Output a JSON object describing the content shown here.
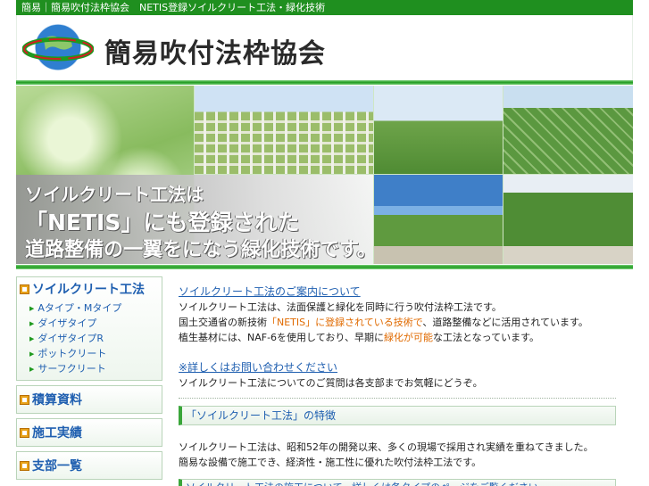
{
  "topbar": {
    "text": "簡易｜簡易吹付法枠協会　NETIS登録ソイルクリート工法・緑化技術"
  },
  "header": {
    "title": "簡易吹付法枠協会",
    "logo_icon": "globe-ring-logo"
  },
  "banner": {
    "lines": [
      "ソイルクリート工法は",
      "「NETIS」にも登録された",
      "道路整備の一翼をになう緑化技術です。"
    ]
  },
  "sidebar": {
    "sections": [
      {
        "label": "ソイルクリート工法",
        "items": [
          "Aタイプ・Mタイプ",
          "ダイザタイプ",
          "ダイザタイプR",
          "ポットクリート",
          "サーフクリート"
        ]
      },
      {
        "label": "積算資料"
      },
      {
        "label": "施工実績"
      },
      {
        "label": "支部一覧"
      }
    ]
  },
  "main": {
    "intro_link": "ソイルクリート工法のご案内について",
    "intro_lines": {
      "l1": "ソイルクリート工法は、法面保護と緑化を同時に行う吹付法枠工法です。",
      "l2a": "国土交通省の新技術",
      "l2b": "「NETIS」に登録されている技術で",
      "l2c": "、道路整備などに活用されています。",
      "l3a": "植生基材には、NAF-6",
      "l3b": "を使用しており、早期に",
      "l3c": "緑化が可能",
      "l3d": "な工法となっています。"
    },
    "note_link": "※詳しくはお問い合わせください",
    "note_text": "ソイルクリート工法についてのご質問は各支部までお気軽にどうぞ。",
    "feature_heading": "「ソイルクリート工法」の特徴",
    "feature_lines": [
      "ソイルクリート工法は、昭和52年の開発以来、多くの現場で採用され実績を重ねてきました。",
      "簡易な設備で施工でき、経済性・施工性に優れた吹付法枠工法です。"
    ],
    "subheading": "ソイルクリート工法の施工について、詳しくは各タイプのページをご覧ください"
  },
  "colors": {
    "accent": "#1f8f1f",
    "link": "#1f5fb0",
    "highlight": "#e06a00"
  }
}
